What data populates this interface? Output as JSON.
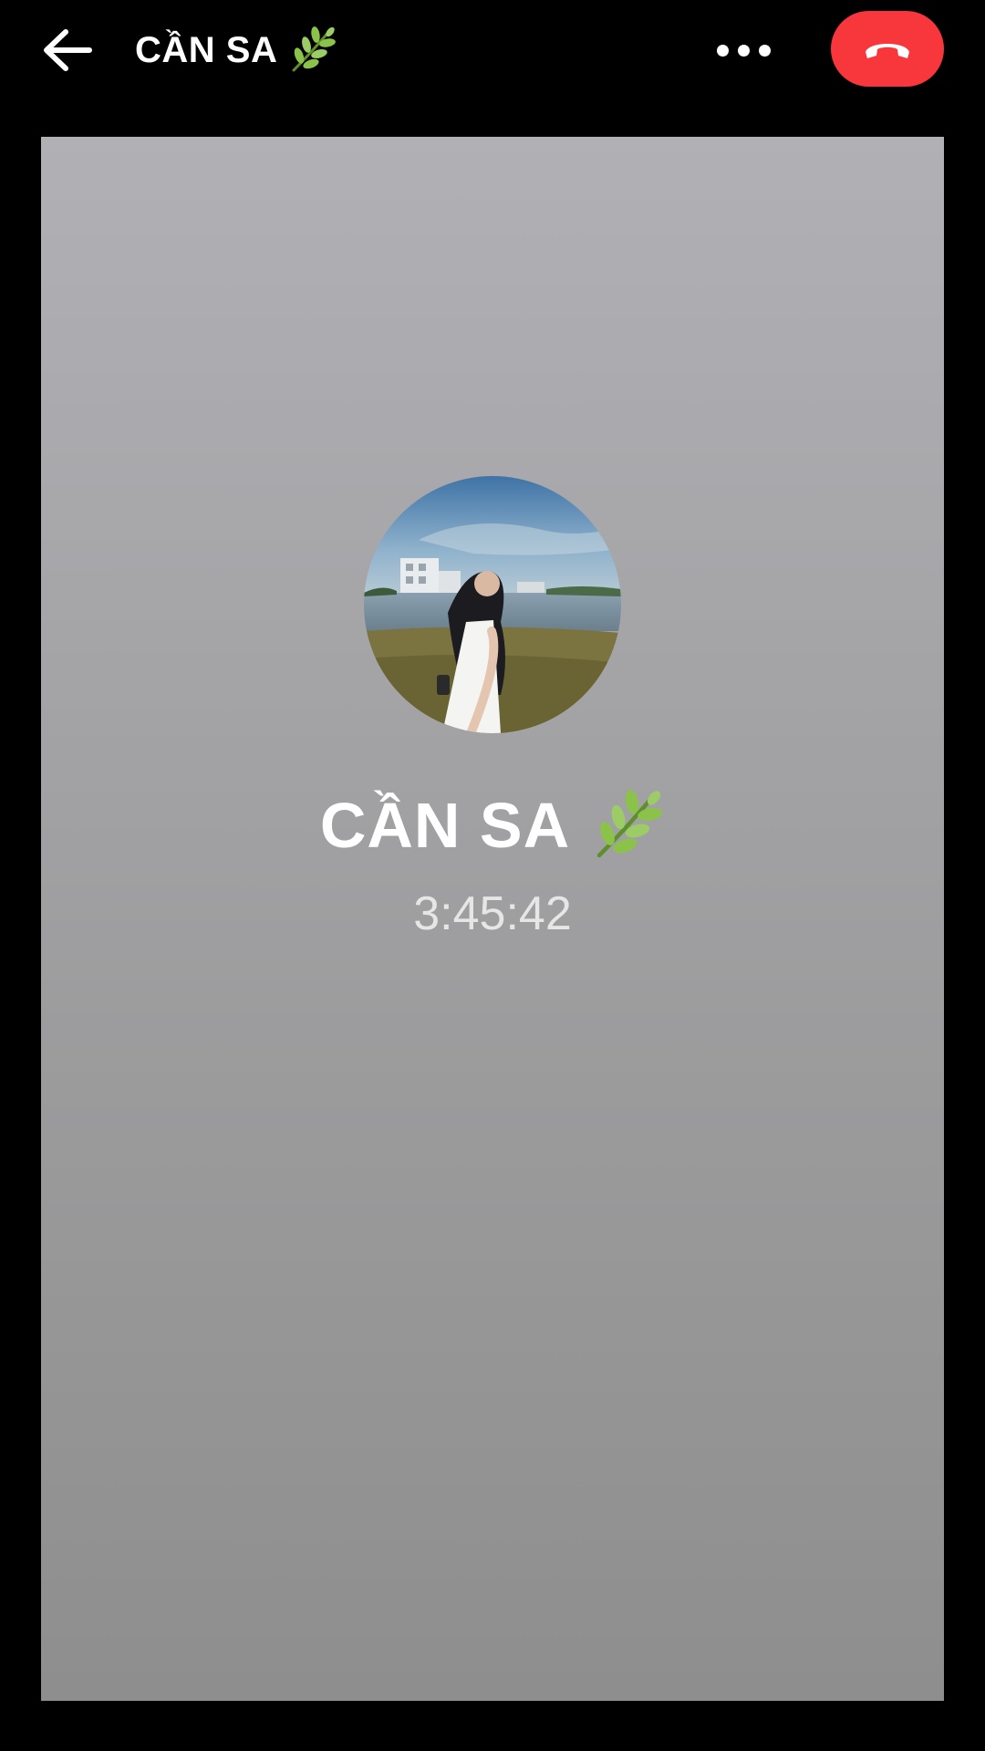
{
  "header": {
    "title": "CẦN SA",
    "back_icon": "arrow-left-icon",
    "more_icon": "more-horizontal-icon",
    "end_call_icon": "phone-hangup-icon",
    "end_call_color": "#f8373c"
  },
  "call": {
    "caller_name": "CẦN SA",
    "name_emoji_icon": "herb-leaf-icon",
    "duration": "3:45:42",
    "avatar": "profile-photo"
  },
  "colors": {
    "background": "#000000",
    "panel_top": "#b1b0b5",
    "panel_bottom": "#8e8e8e"
  }
}
